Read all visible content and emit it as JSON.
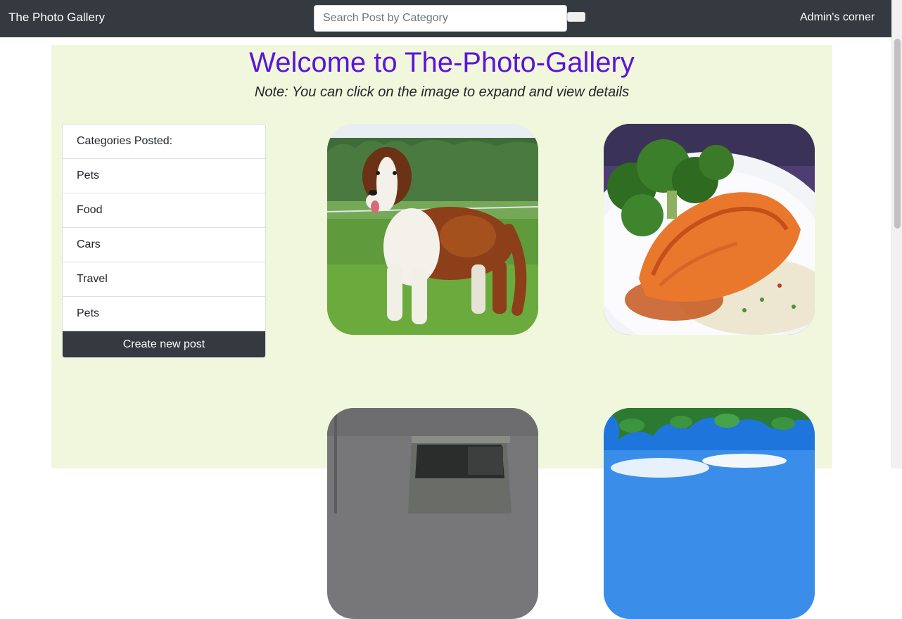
{
  "navbar": {
    "brand": "The Photo Gallery",
    "search_placeholder": "Search Post by Category",
    "search_value": "",
    "admin_link": "Admin's corner"
  },
  "main": {
    "title": "Welcome to The-Photo-Gallery",
    "note": "Note: You can click on the image to expand and view details"
  },
  "categories": {
    "header": "Categories Posted:",
    "items": [
      "Pets",
      "Food",
      "Cars",
      "Travel",
      "Pets"
    ],
    "create_button": "Create new post"
  },
  "gallery": [
    {
      "subject": "dog"
    },
    {
      "subject": "salmon dish with broccoli and rice"
    },
    {
      "subject": "car"
    },
    {
      "subject": "sky and leaves"
    }
  ],
  "colors": {
    "navbar_bg": "#343a40",
    "content_bg": "#f1f7dd",
    "title_color": "#5b14d9"
  }
}
